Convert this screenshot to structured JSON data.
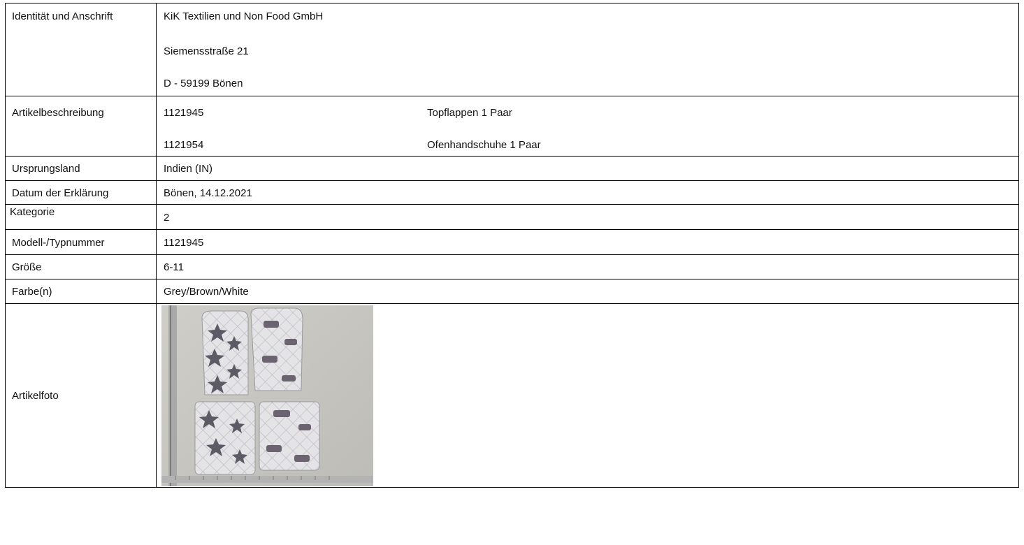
{
  "rows": {
    "identity": {
      "label": "Identität und Anschrift",
      "line1": "KiK Textilien und Non Food GmbH",
      "line2": "Siemensstraße 21",
      "line3": "D - 59199 Bönen"
    },
    "description": {
      "label": "Artikelbeschreibung",
      "items": [
        {
          "number": "1121945",
          "name": "Topflappen 1 Paar"
        },
        {
          "number": "1121954",
          "name": "Ofenhandschuhe 1 Paar"
        }
      ]
    },
    "country": {
      "label": "Ursprungsland",
      "value": "Indien (IN)"
    },
    "date": {
      "label": "Datum der Erklärung",
      "value": "Bönen, 14.12.2021"
    },
    "category": {
      "label": "Kategorie",
      "value": "2"
    },
    "model": {
      "label": "Modell-/Typnummer",
      "value": "1121945"
    },
    "size": {
      "label": "Größe",
      "value": "6-11"
    },
    "color": {
      "label": "Farbe(n)",
      "value": "Grey/Brown/White"
    },
    "photo": {
      "label": "Artikelfoto"
    }
  }
}
